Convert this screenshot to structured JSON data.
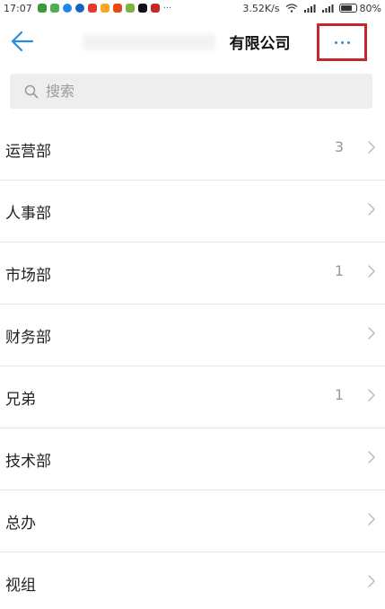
{
  "status_bar": {
    "time": "17:07",
    "net_speed": "3.52K/s",
    "battery_percent": "80%",
    "battery_level": 0.8
  },
  "nav": {
    "title": "有限公司",
    "back_icon": "arrow-left-icon",
    "more_icon": "more-horizontal-icon",
    "accent_color": "#2b8bdc",
    "highlight_color": "#c4282b"
  },
  "search": {
    "placeholder": "搜索",
    "icon": "search-icon"
  },
  "departments": [
    {
      "name": "运营部",
      "count": "3"
    },
    {
      "name": "人事部",
      "count": ""
    },
    {
      "name": "市场部",
      "count": "1"
    },
    {
      "name": "财务部",
      "count": ""
    },
    {
      "name": "兄弟",
      "count": "1"
    },
    {
      "name": "技术部",
      "count": ""
    },
    {
      "name": "总办",
      "count": ""
    },
    {
      "name": "视组",
      "count": ""
    }
  ]
}
